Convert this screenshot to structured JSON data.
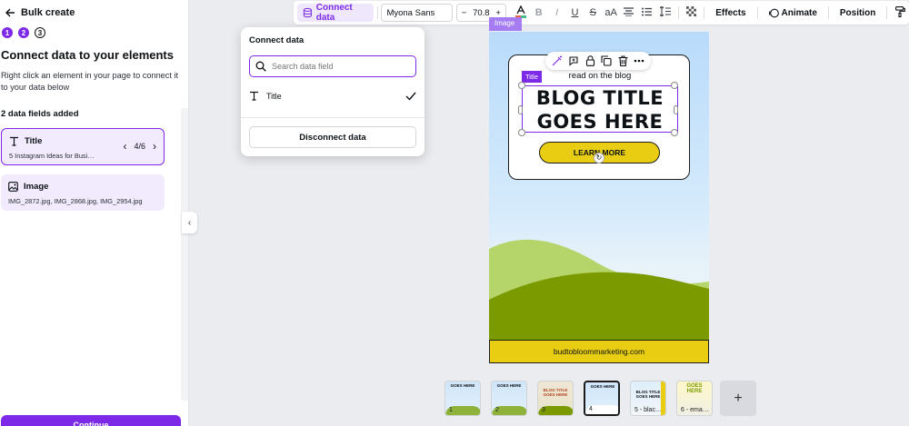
{
  "panel": {
    "back_icon": "arrow-left-icon",
    "title": "Bulk create",
    "steps": [
      "1",
      "2",
      "3"
    ],
    "heading": "Connect data to your elements",
    "description": "Right click an element in your page to connect it to your data below",
    "count": "2 data fields added",
    "fields": [
      {
        "name": "Title",
        "value": "5 Instagram Ideas for Busi…",
        "page": "4/6",
        "icon": "text-t-icon"
      },
      {
        "name": "Image",
        "value": "IMG_2872.jpg, IMG_2868.jpg, IMG_2954.jpg",
        "icon": "image-icon"
      }
    ],
    "continue_label": "Continue"
  },
  "toolbar": {
    "connect_label": "Connect data",
    "font": "Myona Sans",
    "size": "70.8",
    "minus": "−",
    "plus": "+",
    "aa": "aA",
    "effects": "Effects",
    "animate": "Animate",
    "position": "Position"
  },
  "dropdown": {
    "title": "Connect data",
    "search_placeholder": "Search data field",
    "item": "Title",
    "disconnect": "Disconnect data"
  },
  "canvas": {
    "image_tag": "Image",
    "title_tag": "Title",
    "read_blog": "read on the blog",
    "blog_title_line1": "BLOG TITLE",
    "blog_title_line2": "GOES HERE",
    "learn_more": "LEARN MORE",
    "footer": "budtobloommarketing.com",
    "colors": {
      "accent": "#7d2ae8",
      "yellow": "#e9cd13",
      "hill_dark": "#7a9a00",
      "hill_light": "#b5d56a"
    }
  },
  "pages": [
    {
      "num": "1",
      "mini": "GOES HERE"
    },
    {
      "num": "2",
      "mini": "GOES HERE"
    },
    {
      "num": "3",
      "mini": "BLOG TITLE GOES HERE"
    },
    {
      "num": "4",
      "mini": "GOES HERE"
    },
    {
      "num": "5 - blac…",
      "mini": "BLOG TITLE GOES HERE"
    },
    {
      "num": "6 - ema…",
      "mini": "GOES HERE"
    }
  ],
  "add_page": "+"
}
